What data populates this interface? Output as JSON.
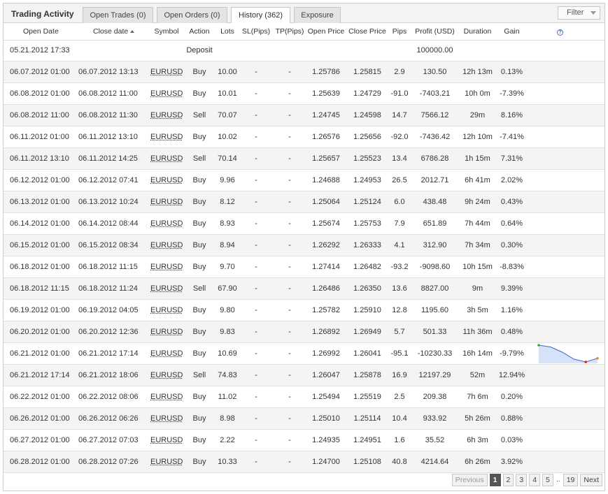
{
  "header": {
    "title": "Trading Activity",
    "tabs": [
      {
        "label": "Open Trades (0)",
        "active": false
      },
      {
        "label": "Open Orders (0)",
        "active": false
      },
      {
        "label": "History (362)",
        "active": true
      },
      {
        "label": "Exposure",
        "active": false
      }
    ],
    "filter_label": "Filter"
  },
  "columns": [
    "Open Date",
    "Close date",
    "Symbol",
    "Action",
    "Lots",
    "SL(Pips)",
    "TP(Pips)",
    "Open Price",
    "Close Price",
    "Pips",
    "Profit (USD)",
    "Duration",
    "Gain"
  ],
  "deposit": {
    "open_date": "05.21.2012 17:33",
    "action": "Deposit",
    "profit": "100000.00"
  },
  "rows": [
    {
      "open": "06.07.2012 01:00",
      "close": "06.07.2012 13:13",
      "symbol": "EURUSD",
      "action": "Buy",
      "lots": "10.00",
      "sl": "-",
      "tp": "-",
      "open_price": "1.25786",
      "close_price": "1.25815",
      "pips": "2.9",
      "profit": "130.50",
      "duration": "12h 13m",
      "gain": "0.13%"
    },
    {
      "open": "06.08.2012 01:00",
      "close": "06.08.2012 11:00",
      "symbol": "EURUSD",
      "action": "Buy",
      "lots": "10.01",
      "sl": "-",
      "tp": "-",
      "open_price": "1.25639",
      "close_price": "1.24729",
      "pips": "-91.0",
      "profit": "-7403.21",
      "duration": "10h 0m",
      "gain": "-7.39%"
    },
    {
      "open": "06.08.2012 11:00",
      "close": "06.08.2012 11:30",
      "symbol": "EURUSD",
      "action": "Sell",
      "lots": "70.07",
      "sl": "-",
      "tp": "-",
      "open_price": "1.24745",
      "close_price": "1.24598",
      "pips": "14.7",
      "profit": "7566.12",
      "duration": "29m",
      "gain": "8.16%"
    },
    {
      "open": "06.11.2012 01:00",
      "close": "06.11.2012 13:10",
      "symbol": "EURUSD",
      "action": "Buy",
      "lots": "10.02",
      "sl": "-",
      "tp": "-",
      "open_price": "1.26576",
      "close_price": "1.25656",
      "pips": "-92.0",
      "profit": "-7436.42",
      "duration": "12h 10m",
      "gain": "-7.41%"
    },
    {
      "open": "06.11.2012 13:10",
      "close": "06.11.2012 14:25",
      "symbol": "EURUSD",
      "action": "Sell",
      "lots": "70.14",
      "sl": "-",
      "tp": "-",
      "open_price": "1.25657",
      "close_price": "1.25523",
      "pips": "13.4",
      "profit": "6786.28",
      "duration": "1h 15m",
      "gain": "7.31%"
    },
    {
      "open": "06.12.2012 01:00",
      "close": "06.12.2012 07:41",
      "symbol": "EURUSD",
      "action": "Buy",
      "lots": "9.96",
      "sl": "-",
      "tp": "-",
      "open_price": "1.24688",
      "close_price": "1.24953",
      "pips": "26.5",
      "profit": "2012.71",
      "duration": "6h 41m",
      "gain": "2.02%"
    },
    {
      "open": "06.13.2012 01:00",
      "close": "06.13.2012 10:24",
      "symbol": "EURUSD",
      "action": "Buy",
      "lots": "8.12",
      "sl": "-",
      "tp": "-",
      "open_price": "1.25064",
      "close_price": "1.25124",
      "pips": "6.0",
      "profit": "438.48",
      "duration": "9h 24m",
      "gain": "0.43%"
    },
    {
      "open": "06.14.2012 01:00",
      "close": "06.14.2012 08:44",
      "symbol": "EURUSD",
      "action": "Buy",
      "lots": "8.93",
      "sl": "-",
      "tp": "-",
      "open_price": "1.25674",
      "close_price": "1.25753",
      "pips": "7.9",
      "profit": "651.89",
      "duration": "7h 44m",
      "gain": "0.64%"
    },
    {
      "open": "06.15.2012 01:00",
      "close": "06.15.2012 08:34",
      "symbol": "EURUSD",
      "action": "Buy",
      "lots": "8.94",
      "sl": "-",
      "tp": "-",
      "open_price": "1.26292",
      "close_price": "1.26333",
      "pips": "4.1",
      "profit": "312.90",
      "duration": "7h 34m",
      "gain": "0.30%"
    },
    {
      "open": "06.18.2012 01:00",
      "close": "06.18.2012 11:15",
      "symbol": "EURUSD",
      "action": "Buy",
      "lots": "9.70",
      "sl": "-",
      "tp": "-",
      "open_price": "1.27414",
      "close_price": "1.26482",
      "pips": "-93.2",
      "profit": "-9098.60",
      "duration": "10h 15m",
      "gain": "-8.83%"
    },
    {
      "open": "06.18.2012 11:15",
      "close": "06.18.2012 11:24",
      "symbol": "EURUSD",
      "action": "Sell",
      "lots": "67.90",
      "sl": "-",
      "tp": "-",
      "open_price": "1.26486",
      "close_price": "1.26350",
      "pips": "13.6",
      "profit": "8827.00",
      "duration": "9m",
      "gain": "9.39%"
    },
    {
      "open": "06.19.2012 01:00",
      "close": "06.19.2012 04:05",
      "symbol": "EURUSD",
      "action": "Buy",
      "lots": "9.80",
      "sl": "-",
      "tp": "-",
      "open_price": "1.25782",
      "close_price": "1.25910",
      "pips": "12.8",
      "profit": "1195.60",
      "duration": "3h 5m",
      "gain": "1.16%"
    },
    {
      "open": "06.20.2012 01:00",
      "close": "06.20.2012 12:36",
      "symbol": "EURUSD",
      "action": "Buy",
      "lots": "9.83",
      "sl": "-",
      "tp": "-",
      "open_price": "1.26892",
      "close_price": "1.26949",
      "pips": "5.7",
      "profit": "501.33",
      "duration": "11h 36m",
      "gain": "0.48%"
    },
    {
      "open": "06.21.2012 01:00",
      "close": "06.21.2012 17:14",
      "symbol": "EURUSD",
      "action": "Buy",
      "lots": "10.69",
      "sl": "-",
      "tp": "-",
      "open_price": "1.26992",
      "close_price": "1.26041",
      "pips": "-95.1",
      "profit": "-10230.33",
      "duration": "16h 14m",
      "gain": "-9.79%",
      "sparkline": true
    },
    {
      "open": "06.21.2012 17:14",
      "close": "06.21.2012 18:06",
      "symbol": "EURUSD",
      "action": "Sell",
      "lots": "74.83",
      "sl": "-",
      "tp": "-",
      "open_price": "1.26047",
      "close_price": "1.25878",
      "pips": "16.9",
      "profit": "12197.29",
      "duration": "52m",
      "gain": "12.94%"
    },
    {
      "open": "06.22.2012 01:00",
      "close": "06.22.2012 08:06",
      "symbol": "EURUSD",
      "action": "Buy",
      "lots": "11.02",
      "sl": "-",
      "tp": "-",
      "open_price": "1.25494",
      "close_price": "1.25519",
      "pips": "2.5",
      "profit": "209.38",
      "duration": "7h 6m",
      "gain": "0.20%"
    },
    {
      "open": "06.26.2012 01:00",
      "close": "06.26.2012 06:26",
      "symbol": "EURUSD",
      "action": "Buy",
      "lots": "8.98",
      "sl": "-",
      "tp": "-",
      "open_price": "1.25010",
      "close_price": "1.25114",
      "pips": "10.4",
      "profit": "933.92",
      "duration": "5h 26m",
      "gain": "0.88%"
    },
    {
      "open": "06.27.2012 01:00",
      "close": "06.27.2012 07:03",
      "symbol": "EURUSD",
      "action": "Buy",
      "lots": "2.22",
      "sl": "-",
      "tp": "-",
      "open_price": "1.24935",
      "close_price": "1.24951",
      "pips": "1.6",
      "profit": "35.52",
      "duration": "6h 3m",
      "gain": "0.03%"
    },
    {
      "open": "06.28.2012 01:00",
      "close": "06.28.2012 07:26",
      "symbol": "EURUSD",
      "action": "Buy",
      "lots": "10.33",
      "sl": "-",
      "tp": "-",
      "open_price": "1.24700",
      "close_price": "1.25108",
      "pips": "40.8",
      "profit": "4214.64",
      "duration": "6h 26m",
      "gain": "3.92%"
    }
  ],
  "sparkline": {
    "values": [
      1.27,
      1.269,
      1.266,
      1.262,
      1.2604,
      1.2625
    ],
    "line_color": "#4a62c8",
    "fill_color": "#d6e2f7",
    "start_color": "#3aa63a",
    "low_color": "#d62a2a",
    "end_color": "#f08a1a"
  },
  "pager": {
    "previous": "Previous",
    "pages": [
      "1",
      "2",
      "3",
      "4",
      "5"
    ],
    "current": "1",
    "ellipsis": "..",
    "last": "19",
    "next": "Next"
  },
  "colors": {
    "positive": "#2f8f2f",
    "negative": "#d22a2a",
    "deposit": "#e98b14",
    "help": "#4b6bc8"
  }
}
